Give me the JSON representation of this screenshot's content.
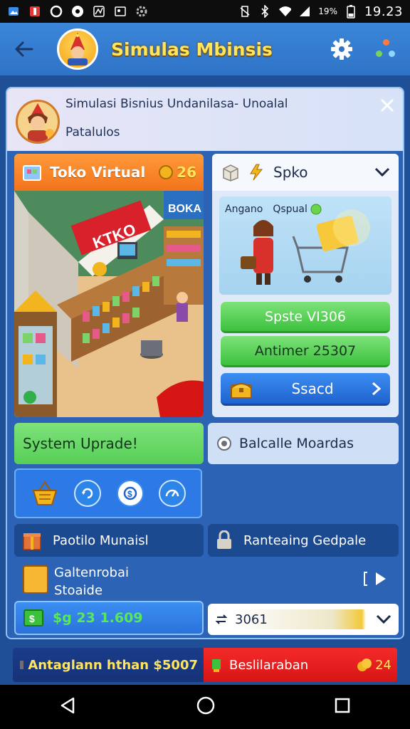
{
  "status": {
    "time": "19.23",
    "battery": "19%"
  },
  "appbar": {
    "title": "Simulas Mbinsis"
  },
  "panel": {
    "title": "Simulasi Bisnius Undanilasa- Unoalal",
    "subtitle": "Patalulos"
  },
  "toko": {
    "label": "Toko Virtual",
    "coins": "26",
    "sign_main": "KTKO",
    "sign_side": "BOKA"
  },
  "shop": {
    "dropdown_label": "Spko",
    "image_caption_1": "Angano",
    "image_caption_2": "Qspual",
    "btn_1": "Spste VI306",
    "btn_2": "Antimer 25307",
    "btn_3": "Ssacd"
  },
  "system": {
    "upgrade_label": "System Uprade!",
    "balance_label": "Balcalle Moardas"
  },
  "rows": {
    "left": "Paotilo Munaisl",
    "right": "Ranteaing Gedpale",
    "gallery_line1": "Galtenrobai",
    "gallery_line2": "Stoaide"
  },
  "money": {
    "value": "$g 23 1.609"
  },
  "dropdown": {
    "value": "3061"
  },
  "ticker": {
    "left": "Antaglann hthan $5007",
    "right": "Beslilaraban",
    "right_value": "24"
  },
  "colors": {
    "accent": "#2f73c6",
    "orange": "#f2731b",
    "green": "#3cc13c",
    "red": "#d61515"
  }
}
